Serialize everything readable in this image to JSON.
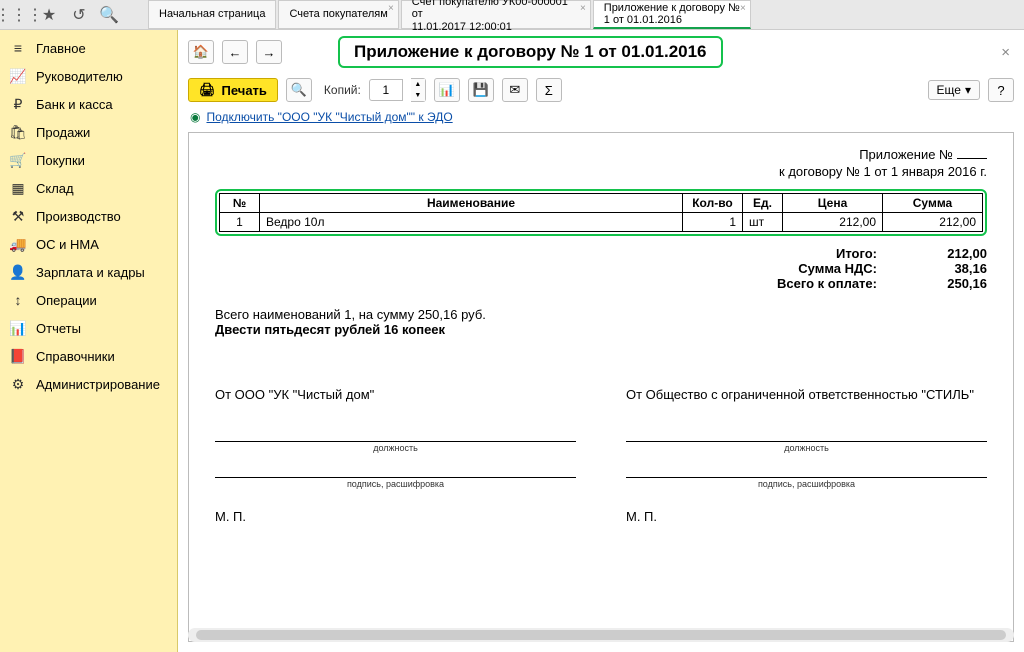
{
  "topbar": {
    "tabs": [
      {
        "line1": "Начальная страница",
        "line2": ""
      },
      {
        "line1": "Счета покупателям",
        "line2": ""
      },
      {
        "line1": "Счет покупателю УК00-000001 от",
        "line2": "11.01.2017 12:00:01"
      },
      {
        "line1": "Приложение к договору №",
        "line2": "1 от 01.01.2016"
      }
    ]
  },
  "sidebar": {
    "items": [
      {
        "icon": "≡",
        "label": "Главное"
      },
      {
        "icon": "📈",
        "label": "Руководителю"
      },
      {
        "icon": "₽",
        "label": "Банк и касса"
      },
      {
        "icon": "🛍",
        "label": "Продажи"
      },
      {
        "icon": "🛒",
        "label": "Покупки"
      },
      {
        "icon": "▦",
        "label": "Склад"
      },
      {
        "icon": "⚒",
        "label": "Производство"
      },
      {
        "icon": "🚚",
        "label": "ОС и НМА"
      },
      {
        "icon": "👤",
        "label": "Зарплата и кадры"
      },
      {
        "icon": "↕",
        "label": "Операции"
      },
      {
        "icon": "📊",
        "label": "Отчеты"
      },
      {
        "icon": "📕",
        "label": "Справочники"
      },
      {
        "icon": "⚙",
        "label": "Администрирование"
      }
    ]
  },
  "page": {
    "title": "Приложение к договору № 1 от 01.01.2016",
    "print_label": "Печать",
    "copies_label": "Копий:",
    "copies_value": "1",
    "more_label": "Еще",
    "edo_link": "Подключить \"ООО \"УК \"Чистый дом\"\" к ЭДО"
  },
  "doc": {
    "header": {
      "app_label": "Приложение №",
      "contract_line": "к договору № 1 от 1 января 2016 г."
    },
    "columns": {
      "n": "№",
      "name": "Наименование",
      "qty": "Кол-во",
      "unit": "Ед.",
      "price": "Цена",
      "sum": "Сумма"
    },
    "rows": [
      {
        "n": "1",
        "name": "Ведро 10л",
        "qty": "1",
        "unit": "шт",
        "price": "212,00",
        "sum": "212,00"
      }
    ],
    "totals": {
      "itogo_lbl": "Итого:",
      "itogo_val": "212,00",
      "nds_lbl": "Сумма НДС:",
      "nds_val": "38,16",
      "total_lbl": "Всего к оплате:",
      "total_val": "250,16"
    },
    "summary_line": "Всего наименований 1, на сумму 250,16 руб.",
    "summary_words": "Двести пятьдесят рублей 16 копеек",
    "from_left": "От ООО \"УК \"Чистый дом\"",
    "from_right": "От Общество с ограниченной ответственностью \"СТИЛЬ\"",
    "sig_position": "должность",
    "sig_sign": "подпись, расшифровка",
    "mp": "М. П."
  }
}
